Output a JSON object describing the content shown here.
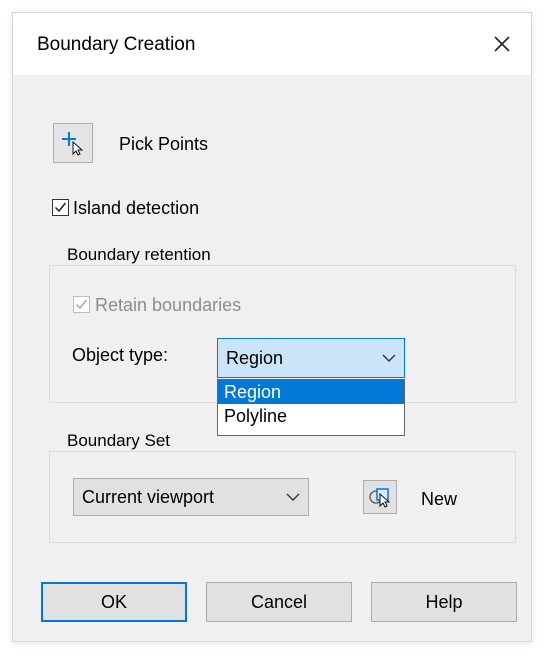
{
  "dialog": {
    "title": "Boundary Creation",
    "close_icon": "close-icon"
  },
  "pick_points": {
    "icon": "pick-points-icon",
    "label": "Pick Points"
  },
  "island_detection": {
    "label": "Island detection",
    "checked": true
  },
  "boundary_retention": {
    "group_label": "Boundary retention",
    "retain_label": "Retain boundaries",
    "retain_checked": true,
    "retain_disabled": true,
    "object_type_label": "Object type:",
    "object_type_value": "Region",
    "object_type_options": [
      "Region",
      "Polyline"
    ],
    "highlighted_option": "Region"
  },
  "boundary_set": {
    "group_label": "Boundary Set",
    "selection": "Current viewport",
    "new_icon": "new-selection-icon",
    "new_label": "New"
  },
  "buttons": {
    "ok": "OK",
    "cancel": "Cancel",
    "help": "Help"
  },
  "colors": {
    "accent": "#0078d7",
    "dialog_bg": "#f0f0f0",
    "combo_focus_bg": "#cce4f7"
  }
}
